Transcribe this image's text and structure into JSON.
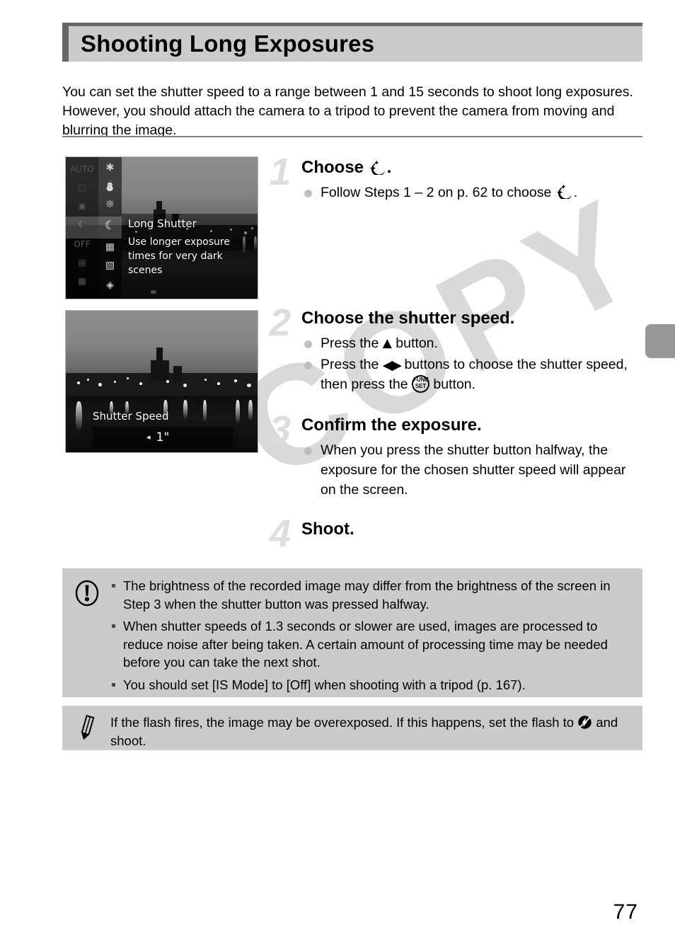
{
  "header": {
    "title": "Shooting Long Exposures"
  },
  "intro": "You can set the shutter speed to a range between 1 and 15 seconds to shoot long exposures. However, you should attach the camera to a tripod to prevent the camera from moving and blurring the image.",
  "watermark": "COPY",
  "screens": {
    "menu": {
      "selected_label": "Long Shutter",
      "description": "Use longer exposure times for very dark scenes",
      "mode_icons": [
        "fish-icon",
        "snowman-icon",
        "fireworks-icon",
        "long-shutter-icon",
        "stitch-assist-left-icon",
        "stitch-assist-right-icon",
        "low-light-icon"
      ],
      "ghost_icons": [
        "auto-icon",
        "program-icon",
        "portrait-icon",
        "long-shutter-icon",
        "color-accent-icon",
        "miniature-icon",
        "toy-camera-icon"
      ]
    },
    "shutter": {
      "label": "Shutter Speed",
      "value": "1\"",
      "left_arrow": "◂"
    }
  },
  "steps": [
    {
      "number": "1",
      "title_prefix": "Choose ",
      "title_icon": "long-shutter-icon",
      "title_suffix": ".",
      "bullets": [
        {
          "before": "Follow Steps 1 – 2 on p. 62 to choose ",
          "icon": "long-shutter-icon",
          "after": "."
        }
      ]
    },
    {
      "number": "2",
      "title_prefix": "Choose the shutter speed.",
      "title_icon": "",
      "title_suffix": "",
      "bullets": [
        {
          "before": "Press the ",
          "icon": "up-button-icon",
          "after": " button."
        },
        {
          "before": "Press the ",
          "icon": "left-right-buttons-icon",
          "mid": " buttons to choose the shutter speed, then press the ",
          "icon2": "func-set-button-icon",
          "after": " button."
        }
      ]
    },
    {
      "number": "3",
      "title_prefix": "Confirm the exposure.",
      "title_icon": "",
      "title_suffix": "",
      "bullets": [
        {
          "before": "When you press the shutter button halfway, the exposure for the chosen shutter speed will appear on the screen.",
          "icon": "",
          "after": ""
        }
      ]
    },
    {
      "number": "4",
      "title_prefix": "Shoot.",
      "title_icon": "",
      "title_suffix": "",
      "bullets": []
    }
  ],
  "caution_box": {
    "icon": "caution-icon",
    "bullets": [
      "The brightness of the recorded image may differ from the brightness of the screen in Step 3 when the shutter button was pressed halfway.",
      "When shutter speeds of 1.3 seconds or slower are used, images are processed to reduce noise after being taken. A certain amount of processing time may be needed before you can take the next shot.",
      "You should set [IS Mode] to [Off] when shooting with a tripod (p. 167)."
    ]
  },
  "note_box": {
    "icon": "pencil-note-icon",
    "text_before": "If the flash fires, the image may be overexposed. If this happens, set the flash to ",
    "inline_icon": "flash-off-icon",
    "text_after": " and shoot."
  },
  "func_button": {
    "top": "FUNC",
    "bottom": "SET"
  },
  "page_number": "77",
  "colors": {
    "header_fill": "#cbcbcb",
    "header_bar": "#666666",
    "box_fill": "#cbcbcb",
    "step_number": "#dddddd",
    "bullet_dot": "#bfbfbf",
    "side_tab": "#989898",
    "watermark": "#d9d9d9"
  }
}
